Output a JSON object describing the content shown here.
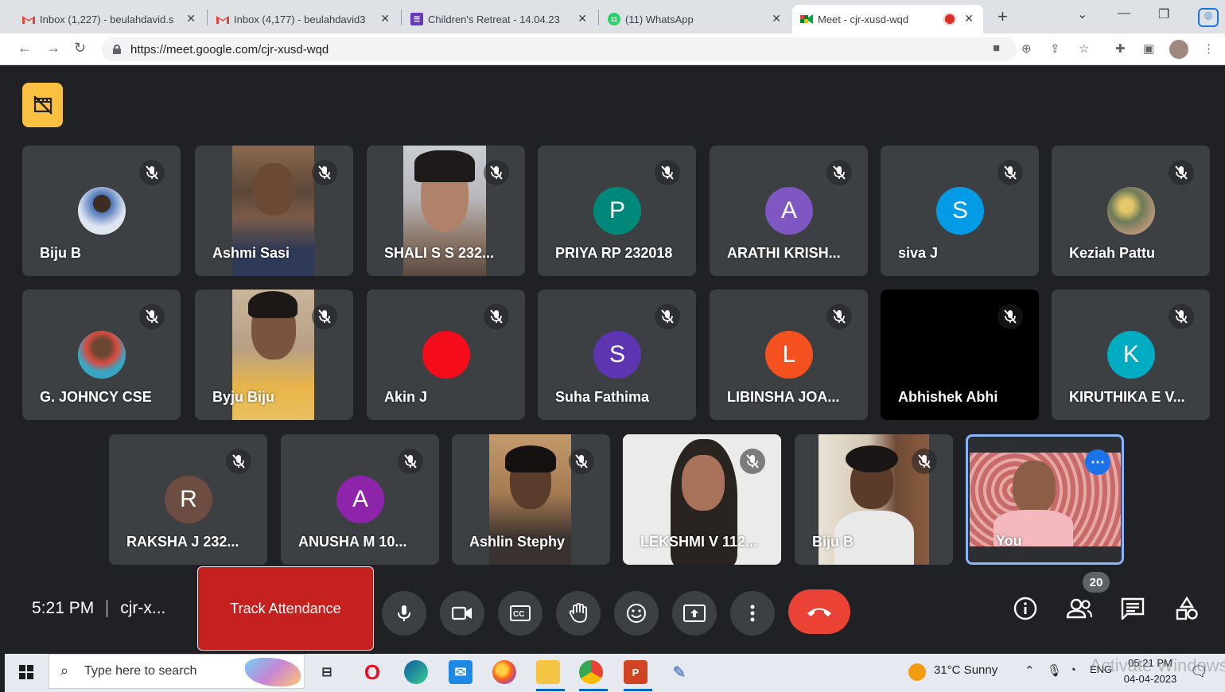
{
  "browser": {
    "tabs": [
      {
        "title": "Inbox (1,227) - beulahdavid.s",
        "icon": "gmail-icon",
        "active": false
      },
      {
        "title": "Inbox (4,177) - beulahdavid3",
        "icon": "gmail-icon",
        "active": false
      },
      {
        "title": "Children's Retreat - 14.04.23",
        "icon": "forms-icon",
        "active": false
      },
      {
        "title": "(11) WhatsApp",
        "icon": "whatsapp-icon",
        "active": false
      },
      {
        "title": "Meet - cjr-xusd-wqd",
        "icon": "meet-icon",
        "active": true,
        "recording": true
      }
    ],
    "url": "https://meet.google.com/cjr-xusd-wqd"
  },
  "meet": {
    "participants_row1": [
      {
        "name": "Biju B",
        "type": "photo-avatar"
      },
      {
        "name": "Ashmi Sasi",
        "type": "video"
      },
      {
        "name": "SHALI S S 232...",
        "type": "video"
      },
      {
        "name": "PRIYA RP 232018",
        "type": "letter",
        "letter": "P",
        "color": "#00897b"
      },
      {
        "name": "ARATHI KRISH...",
        "type": "letter",
        "letter": "A",
        "color": "#7e57c2"
      },
      {
        "name": "siva J",
        "type": "letter",
        "letter": "S",
        "color": "#039be5"
      },
      {
        "name": "Keziah Pattu",
        "type": "photo-avatar"
      }
    ],
    "participants_row2": [
      {
        "name": "G. JOHNCY CSE",
        "type": "photo-avatar"
      },
      {
        "name": "Byju Biju",
        "type": "video"
      },
      {
        "name": "Akin J",
        "type": "letter",
        "letter": "",
        "color": "#f40c1b"
      },
      {
        "name": "Suha Fathima",
        "type": "letter",
        "letter": "S",
        "color": "#5e35b1"
      },
      {
        "name": "LIBINSHA JOA...",
        "type": "letter",
        "letter": "L",
        "color": "#f4511e"
      },
      {
        "name": "Abhishek Abhi",
        "type": "black"
      },
      {
        "name": "KIRUTHIKA E V...",
        "type": "letter",
        "letter": "K",
        "color": "#00acc1"
      }
    ],
    "participants_row3": [
      {
        "name": "RAKSHA J 232...",
        "type": "letter",
        "letter": "R",
        "color": "#6d4c41"
      },
      {
        "name": "ANUSHA M 10...",
        "type": "letter",
        "letter": "A",
        "color": "#8e24aa"
      },
      {
        "name": "Ashlin Stephy",
        "type": "video"
      },
      {
        "name": "LEKSHMI V 112...",
        "type": "video"
      },
      {
        "name": "Biju B",
        "type": "video"
      },
      {
        "name": "You",
        "type": "self"
      }
    ],
    "time": "5:21 PM",
    "meeting_code": "cjr-x...",
    "track_attendance": "Track Attendance",
    "people_count": "20"
  },
  "taskbar": {
    "search_placeholder": "Type here to search",
    "weather": "31°C  Sunny",
    "lang": "ENG",
    "time": "05:21 PM",
    "date": "04-04-2023",
    "watermark": "Activate Windows"
  }
}
